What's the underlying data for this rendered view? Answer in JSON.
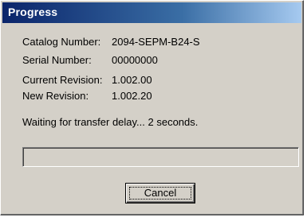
{
  "window": {
    "title": "Progress"
  },
  "details": [
    {
      "label": "Catalog Number:",
      "value": "2094-SEPM-B24-S"
    },
    {
      "label": "Serial Number:",
      "value": "00000000"
    },
    {
      "label": "Current Revision:",
      "value": "1.002.00"
    },
    {
      "label": "New Revision:",
      "value": "1.002.20"
    }
  ],
  "status": {
    "message": "Waiting for transfer delay... 2 seconds."
  },
  "progress": {
    "fraction": 0
  },
  "buttons": {
    "cancel_label": "Cancel"
  },
  "colors": {
    "title_bar_start": "#0a246a",
    "title_bar_end": "#a6caf0",
    "dialog_face": "#d4d0c8"
  }
}
